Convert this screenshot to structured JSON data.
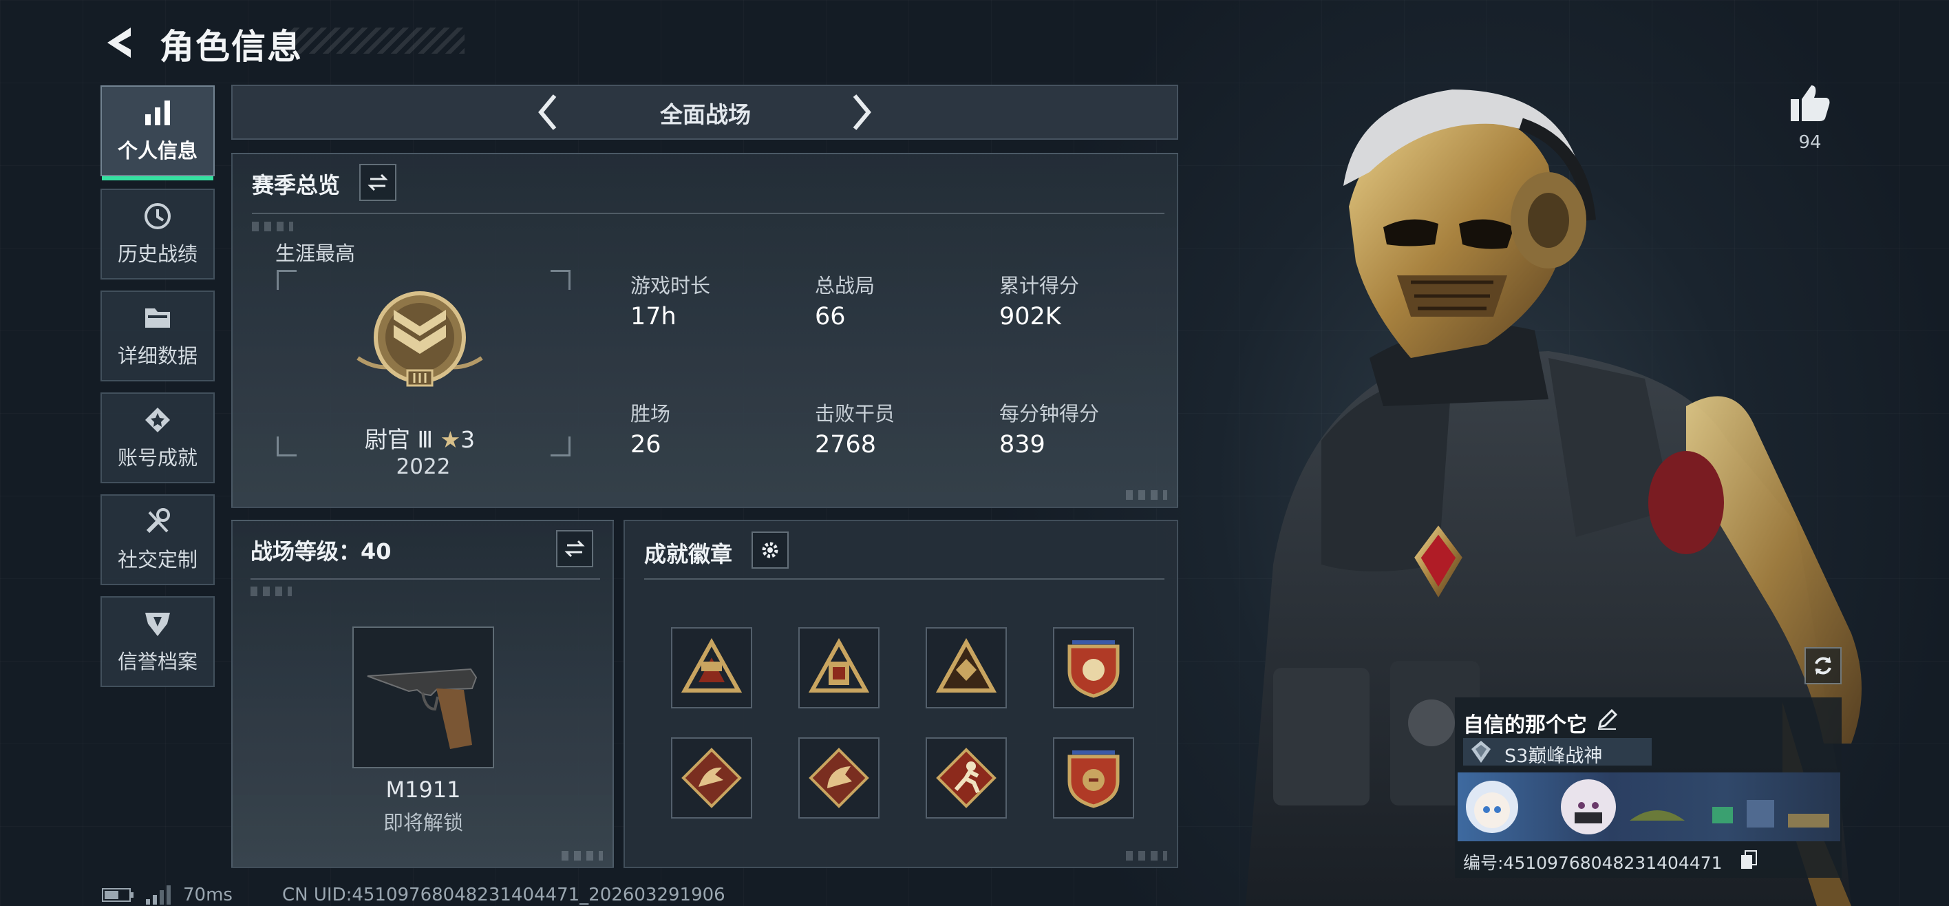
{
  "header": {
    "title": "角色信息"
  },
  "sidebar": {
    "items": [
      {
        "label": "个人信息",
        "icon": "bar-chart-icon",
        "active": true
      },
      {
        "label": "历史战绩",
        "icon": "history-clock-icon",
        "active": false
      },
      {
        "label": "详细数据",
        "icon": "folder-icon",
        "active": false
      },
      {
        "label": "账号成就",
        "icon": "achievement-star-icon",
        "active": false
      },
      {
        "label": "社交定制",
        "icon": "tools-icon",
        "active": false
      },
      {
        "label": "信誉档案",
        "icon": "shield-icon",
        "active": false
      }
    ]
  },
  "mode_selector": {
    "label": "全面战场",
    "prev_icon": "chevron-left-icon",
    "next_icon": "chevron-right-icon"
  },
  "season_overview": {
    "title": "赛季总览",
    "career_best_label": "生涯最高",
    "rank_name": "尉官 Ⅲ",
    "rank_stars": "3",
    "rank_score": "2022",
    "stats": [
      {
        "label": "游戏时长",
        "value": "17h"
      },
      {
        "label": "总战局",
        "value": "66"
      },
      {
        "label": "累计得分",
        "value": "902K"
      },
      {
        "label": "胜场",
        "value": "26"
      },
      {
        "label": "击败干员",
        "value": "2768"
      },
      {
        "label": "每分钟得分",
        "value": "839"
      }
    ]
  },
  "battlefield_level": {
    "title": "战场等级：40",
    "weapon_name": "M1911",
    "weapon_status": "即将解锁"
  },
  "achievements": {
    "title": "成就徽章",
    "badges": [
      "triangle-badge-1",
      "triangle-badge-2",
      "triangle-badge-3",
      "shield-badge-1",
      "dragon-badge-1",
      "dragon-badge-2",
      "runner-badge",
      "shield-badge-2"
    ]
  },
  "likes": {
    "count": "94"
  },
  "profile": {
    "nickname": "自信的那个它",
    "title_badge": "S3巅峰战神",
    "id_text": "编号:4510976804823140447​1"
  },
  "status_bar": {
    "ping": "70ms",
    "uid": "CN UID:45109768048231404471_202603291906"
  },
  "colors": {
    "accent": "#35e0a0",
    "gold": "#c9a560",
    "panel": "#26303a"
  }
}
